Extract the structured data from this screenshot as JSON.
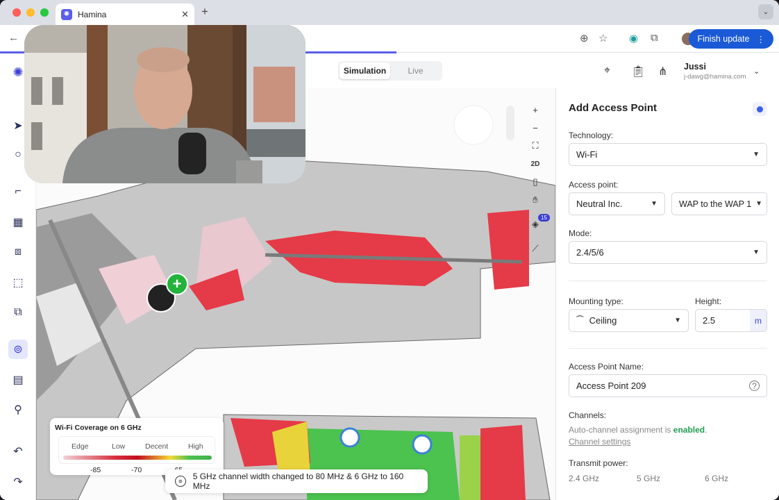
{
  "browser": {
    "tab_title": "Hamina",
    "tab_favicon": "hamina-logo-icon",
    "finish_update_label": "Finish update"
  },
  "topbar": {
    "modes": [
      "Simulation",
      "Live"
    ],
    "active_mode": "Simulation",
    "user_name": "Jussi",
    "user_email": "j-dawg@hamina.com"
  },
  "map_controls": {
    "view_mode_label": "2D",
    "layers_badge": "15"
  },
  "legend": {
    "title": "Wi-Fi Coverage on 6 GHz",
    "categories": [
      "Edge",
      "Low",
      "Decent",
      "High"
    ],
    "values": [
      "-85",
      "-70",
      "-65"
    ]
  },
  "toast": {
    "message": "5 GHz channel width changed to 80 MHz & 6 GHz to 160 MHz"
  },
  "panel": {
    "title": "Add Access Point",
    "technology_label": "Technology:",
    "technology_value": "Wi-Fi",
    "access_point_label": "Access point:",
    "vendor_value": "Neutral Inc.",
    "model_value": "WAP to the WAP 1",
    "mode_label": "Mode:",
    "mode_value": "2.4/5/6",
    "mounting_label": "Mounting type:",
    "mounting_value": "Ceiling",
    "height_label": "Height:",
    "height_value": "2.5",
    "height_unit": "m",
    "name_label": "Access Point Name:",
    "name_value": "Access Point 209",
    "channels_label": "Channels:",
    "auto_channel_text": "Auto-channel assignment is",
    "auto_channel_status": "enabled",
    "auto_channel_period": ".",
    "channel_settings_link": "Channel settings",
    "transmit_label": "Transmit power:",
    "bands": [
      "2.4 GHz",
      "5 GHz",
      "6 GHz"
    ]
  },
  "colors": {
    "accent": "#3b3fd8",
    "enabled": "#1e9e52",
    "browser_blue": "#1a5ad6"
  }
}
